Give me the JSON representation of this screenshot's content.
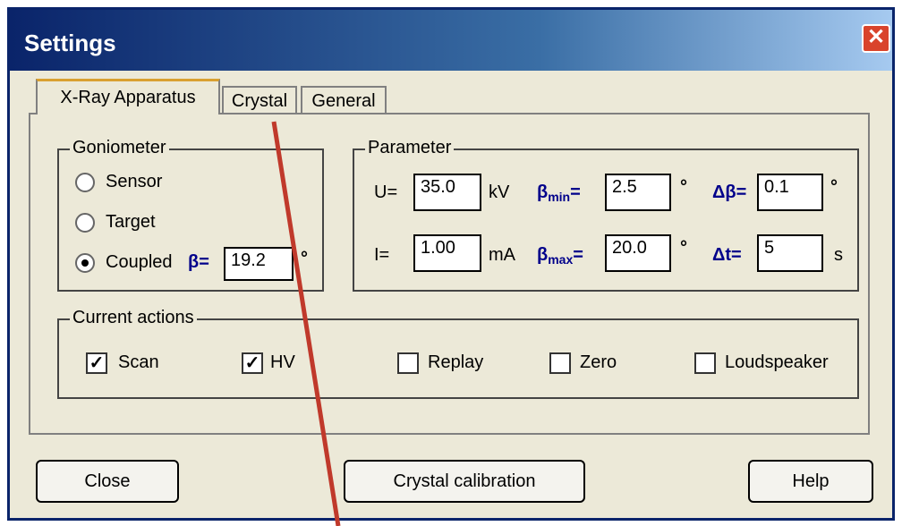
{
  "window": {
    "title": "Settings"
  },
  "tabs": [
    {
      "label": "X-Ray Apparatus"
    },
    {
      "label": "Crystal"
    },
    {
      "label": "General"
    }
  ],
  "goniometer": {
    "legend": "Goniometer",
    "options": [
      "Sensor",
      "Target",
      "Coupled"
    ],
    "selected": "Coupled",
    "beta_label": "β=",
    "beta_value": "19.2",
    "degree": "°"
  },
  "parameter": {
    "legend": "Parameter",
    "U_label": "U=",
    "U_value": "35.0",
    "U_unit": "kV",
    "I_label": "I=",
    "I_value": "1.00",
    "I_unit": "mA",
    "bmin_label": "β",
    "bmin_sub": "min",
    "bmin_eq": "=",
    "bmin_value": "2.5",
    "bmax_label": "β",
    "bmax_sub": "max",
    "bmax_eq": "=",
    "bmax_value": "20.0",
    "dbeta_label": "Δβ=",
    "dbeta_value": "0.1",
    "dt_label": "Δt=",
    "dt_value": "5",
    "dt_unit": "s",
    "degree": "°"
  },
  "current_actions": {
    "legend": "Current actions",
    "items": [
      {
        "label": "Scan",
        "checked": true
      },
      {
        "label": "HV",
        "checked": true
      },
      {
        "label": "Replay",
        "checked": false
      },
      {
        "label": "Zero",
        "checked": false
      },
      {
        "label": "Loudspeaker",
        "checked": false
      }
    ]
  },
  "buttons": {
    "close": "Close",
    "calibration": "Crystal calibration",
    "help": "Help"
  },
  "colors": {
    "accent_line": "#c0392b",
    "titlebar": "#0a246a"
  }
}
